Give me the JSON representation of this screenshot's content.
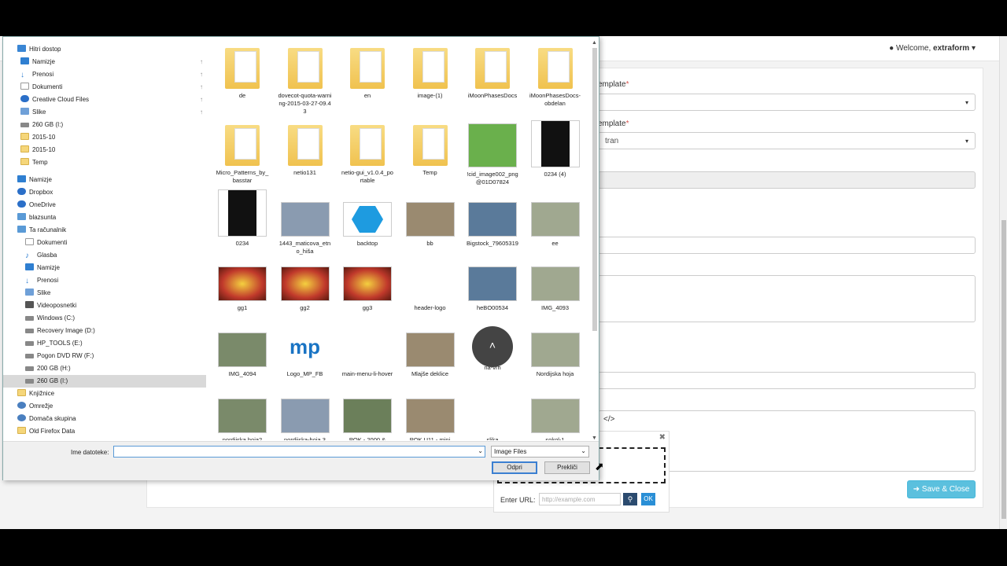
{
  "app": {
    "welcome_prefix": "Welcome,",
    "user": "extraform",
    "label_template1": "emplate",
    "label_template2": "emplate",
    "select2_value": "tran",
    "save_close": "Save & Close"
  },
  "popup": {
    "url_label": "Enter URL:",
    "url_placeholder": "http://example.com",
    "ok": "OK"
  },
  "dialog": {
    "nav": [
      {
        "label": "Hitri dostop",
        "icon": "star"
      },
      {
        "label": "Namizje",
        "icon": "blue",
        "pin": true
      },
      {
        "label": "Prenosi",
        "icon": "dl",
        "pin": true
      },
      {
        "label": "Dokumenti",
        "icon": "doc",
        "pin": true
      },
      {
        "label": "Creative Cloud Files",
        "icon": "cloud",
        "pin": true
      },
      {
        "label": "Slike",
        "icon": "pic",
        "pin": true
      },
      {
        "label": "260 GB (I:)",
        "icon": "drive"
      },
      {
        "label": "2015-10",
        "icon": "folder"
      },
      {
        "label": "2015-10",
        "icon": "folder"
      },
      {
        "label": "Temp",
        "icon": "folder"
      },
      {
        "label": "Namizje",
        "icon": "blue"
      },
      {
        "label": "Dropbox",
        "icon": "cloud"
      },
      {
        "label": "OneDrive",
        "icon": "cloud"
      },
      {
        "label": "blazsunta",
        "icon": "pc"
      },
      {
        "label": "Ta računalnik",
        "icon": "pc"
      },
      {
        "label": "Dokumenti",
        "icon": "doc"
      },
      {
        "label": "Glasba",
        "icon": "music"
      },
      {
        "label": "Namizje",
        "icon": "blue"
      },
      {
        "label": "Prenosi",
        "icon": "dl"
      },
      {
        "label": "Slike",
        "icon": "pic"
      },
      {
        "label": "Videoposnetki",
        "icon": "vid"
      },
      {
        "label": "Windows (C:)",
        "icon": "drive"
      },
      {
        "label": "Recovery Image (D:)",
        "icon": "drive"
      },
      {
        "label": "HP_TOOLS (E:)",
        "icon": "drive"
      },
      {
        "label": "Pogon DVD RW (F:)",
        "icon": "drive"
      },
      {
        "label": "200 GB (H:)",
        "icon": "drive"
      },
      {
        "label": "260 GB (I:)",
        "icon": "drive",
        "selected": true
      },
      {
        "label": "Knjižnice",
        "icon": "folder"
      },
      {
        "label": "Omrežje",
        "icon": "net"
      },
      {
        "label": "Domača skupina",
        "icon": "net"
      },
      {
        "label": "Old Firefox Data",
        "icon": "folder"
      }
    ],
    "files": [
      {
        "name": "de",
        "kind": "folder"
      },
      {
        "name": "dovecot-quota-warning-2015-03-27-09.43",
        "kind": "folder"
      },
      {
        "name": "en",
        "kind": "folder"
      },
      {
        "name": "image-(1)",
        "kind": "folder"
      },
      {
        "name": "iMoonPhasesDocs",
        "kind": "folder"
      },
      {
        "name": "iMoonPhasesDocs-obdelan",
        "kind": "folder"
      },
      {
        "name": "Micro_Patterns_by_basstar",
        "kind": "folder"
      },
      {
        "name": "netio131",
        "kind": "folder"
      },
      {
        "name": "netio-gui_v1.0.4_portable",
        "kind": "folder"
      },
      {
        "name": "Temp",
        "kind": "folder"
      },
      {
        "name": "!cid_image002_png@01D07824",
        "kind": "green"
      },
      {
        "name": "0234 (4)",
        "kind": "pants"
      },
      {
        "name": "0234",
        "kind": "pants"
      },
      {
        "name": "1443_maticova_etno_hiša",
        "kind": "photo"
      },
      {
        "name": "backtop",
        "kind": "hex"
      },
      {
        "name": "bb",
        "kind": "photo"
      },
      {
        "name": "Bigstock_79605319",
        "kind": "photo"
      },
      {
        "name": "ee",
        "kind": "photo"
      },
      {
        "name": "gg1",
        "kind": "food"
      },
      {
        "name": "gg2",
        "kind": "food"
      },
      {
        "name": "gg3",
        "kind": "food"
      },
      {
        "name": "header-logo",
        "kind": "logo"
      },
      {
        "name": "heBO00534",
        "kind": "photo"
      },
      {
        "name": "IMG_4093",
        "kind": "photo"
      },
      {
        "name": "IMG_4094",
        "kind": "photo"
      },
      {
        "name": "Logo_MP_FB",
        "kind": "mp"
      },
      {
        "name": "main-menu-li-hover",
        "kind": "palm"
      },
      {
        "name": "Mlajše deklice",
        "kind": "photo"
      },
      {
        "name": "na-vrh",
        "kind": "circle"
      },
      {
        "name": "Nordijska hoja",
        "kind": "photo"
      },
      {
        "name": "nordijska hoja2",
        "kind": "photo"
      },
      {
        "name": "nordijska-hoja 3",
        "kind": "photo"
      },
      {
        "name": "POK - 2000 &",
        "kind": "photo"
      },
      {
        "name": "POK U11 - mini",
        "kind": "photo"
      },
      {
        "name": "slika",
        "kind": "bottle"
      },
      {
        "name": "sokol-1",
        "kind": "photo"
      }
    ],
    "filename_label": "Ime datoteke:",
    "filename_value": "",
    "filetype": "Image Files",
    "open": "Odpri",
    "cancel": "Prekliči"
  },
  "colors": {
    "accent": "#3b7fd1",
    "save_button": "#5bc0de",
    "folder": "#f0c24f"
  }
}
